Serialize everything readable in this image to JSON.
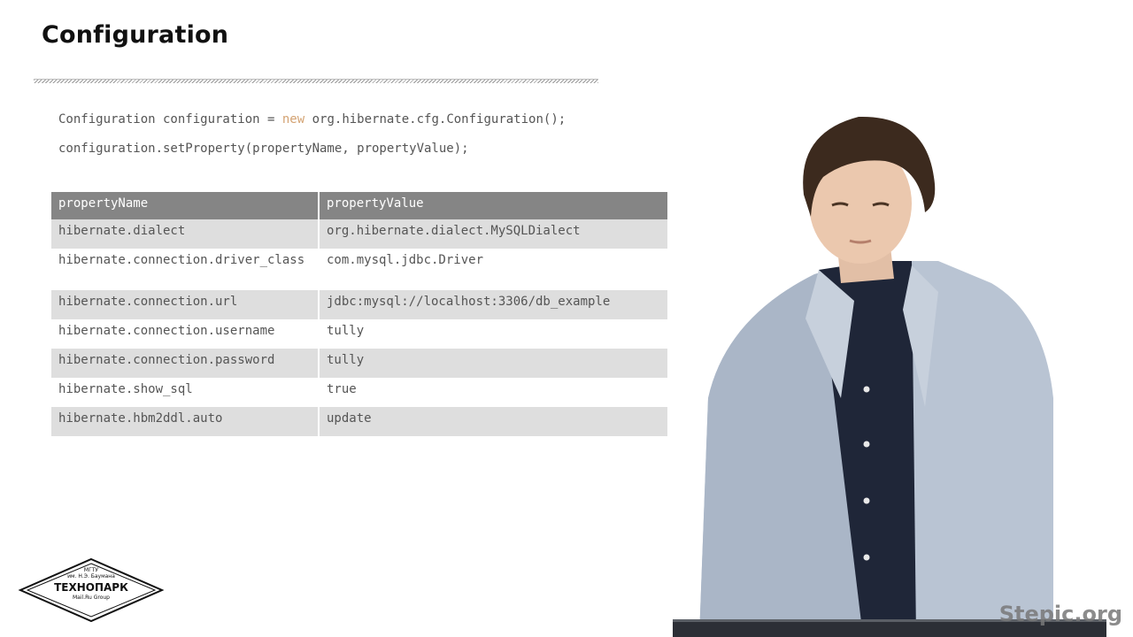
{
  "title": "Configuration",
  "code": {
    "line1_before": "Configuration configuration = ",
    "line1_keyword": "new",
    "line1_after": " org.hibernate.cfg.Configuration();",
    "line2": "configuration.setProperty(propertyName, propertyValue);"
  },
  "table": {
    "headers": [
      "propertyName",
      "propertyValue"
    ],
    "rows": [
      {
        "name": "hibernate.dialect",
        "value": "org.hibernate.dialect.MySQLDialect"
      },
      {
        "name": "hibernate.connection.driver_class",
        "value": "com.mysql.jdbc.Driver"
      },
      {
        "name": "hibernate.connection.url",
        "value": "jdbc:mysql://localhost:3306/db_example"
      },
      {
        "name": "hibernate.connection.username",
        "value": "tully"
      },
      {
        "name": "hibernate.connection.password",
        "value": "tully"
      },
      {
        "name": "hibernate.show_sql",
        "value": "true"
      },
      {
        "name": "hibernate.hbm2ddl.auto",
        "value": "update"
      }
    ]
  },
  "logo": {
    "line1": "МГТУ",
    "line2": "им. Н.Э. Баумана",
    "name": "ТЕХНОПАРК",
    "sub": "Mail.Ru Group"
  },
  "watermark": "Stepic.org",
  "colors": {
    "header_bg": "#858585",
    "row_shade": "#dedede",
    "keyword": "#d4a373"
  }
}
